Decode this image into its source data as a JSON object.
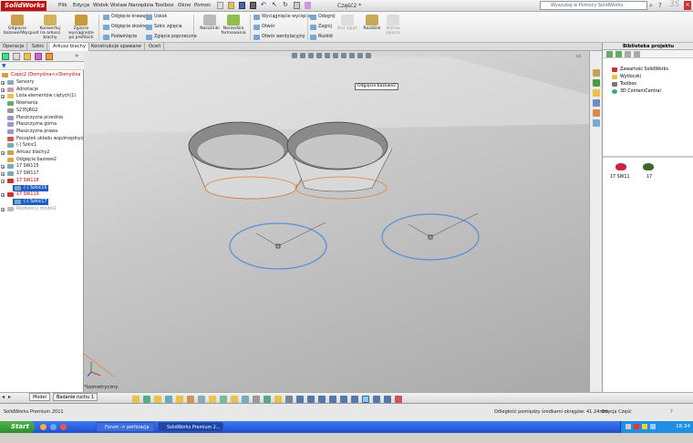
{
  "app": {
    "name": "SolidWorks",
    "doc_title": "Część2 *"
  },
  "menu": [
    "Plik",
    "Edycja",
    "Widok",
    "Wstaw",
    "Narzędzia",
    "Toolbox",
    "Okno",
    "Pomoc"
  ],
  "help_search": {
    "placeholder": "Wyszukaj w Pomocy SolidWorks"
  },
  "ribbon": {
    "big_buttons": [
      "Odgięcie bazowe/Wyspust",
      "Konwertuj na arkusz blachy",
      "Zgięcie wyciągnięte po profilach",
      "Narożniki",
      "Narzędzie formowania"
    ],
    "small_buttons": [
      "Odgięcie krawędzi",
      "Odgięcie skośne",
      "Podwinięcie",
      "Uskok",
      "Szkic zgięcia",
      "Zgięcie poprzeczne",
      "Wyciągnięcie wycięcia",
      "Otwór",
      "Otwór wentylacyjny",
      "Odegnij",
      "Zagnij",
      "Rozkłd"
    ],
    "disabled_buttons": [
      "Bez zgięć",
      "Wstaw zgięcia"
    ],
    "rozdziel": "Rozdziel"
  },
  "tabs": [
    "Operacje",
    "Szkic",
    "Arkusz blachy",
    "Konstrukcje spawane",
    "Oceń"
  ],
  "active_tab": "Arkusz blachy",
  "feature_tree": {
    "root": "Część2 (Domyślna<<Domyślna",
    "items": [
      {
        "label": "Sensory",
        "style": "normal"
      },
      {
        "label": "Adnotacje",
        "style": "normal"
      },
      {
        "label": "Lista elementów ciętych(1)",
        "style": "normal"
      },
      {
        "label": "Równania",
        "style": "normal"
      },
      {
        "label": "S235JRG2",
        "style": "normal"
      },
      {
        "label": "Płaszczyzna przednia",
        "style": "normal"
      },
      {
        "label": "Płaszczyzna górna",
        "style": "normal"
      },
      {
        "label": "Płaszczyzna prawa",
        "style": "normal"
      },
      {
        "label": "Początek układu współrzędnych",
        "style": "normal"
      },
      {
        "label": "(-) Szkic1",
        "style": "normal"
      },
      {
        "label": "Arkusz blachy2",
        "style": "normal"
      },
      {
        "label": "Odgięcie bazowe2",
        "style": "normal"
      },
      {
        "label": "17 SW115",
        "style": "normal"
      },
      {
        "label": "17 SW117",
        "style": "normal"
      },
      {
        "label": "17 SW118",
        "style": "red"
      },
      {
        "label": "(-) Szkic16",
        "style": "sel"
      },
      {
        "label": "17 SW119",
        "style": "red"
      },
      {
        "label": "(-) Szkic17",
        "style": "sel"
      },
      {
        "label": "Rozłożony model2",
        "style": "grey"
      }
    ]
  },
  "viewport": {
    "tooltip": "Odgięcie bazowe2",
    "view_label": "*Izometryczny"
  },
  "design_library": {
    "title": "Biblioteka projektu",
    "items": [
      "Zawartość SolidWorks",
      "Wytłoczki",
      "Toolbox",
      "3D ContentCentral"
    ],
    "parts": [
      "17 SW11",
      "17"
    ]
  },
  "model_tabs": [
    "Model",
    "Badanie ruchu 1"
  ],
  "status": {
    "app_version": "SolidWorks Premium 2011",
    "measurement": "Odległość pomiędzy środkami okręgów: 41.24mm",
    "mode": "Edycja Część"
  },
  "taskbar": {
    "start": "Start",
    "windows": [
      "Forum -> perforacja ...",
      "SolidWorks Premium 2..."
    ],
    "clock": "16:34"
  },
  "colors": {
    "accent": "#1e5cc8",
    "brand": "#b11111",
    "sketch_circle": "#5b8fd6",
    "edge_orange": "#e0823a"
  }
}
